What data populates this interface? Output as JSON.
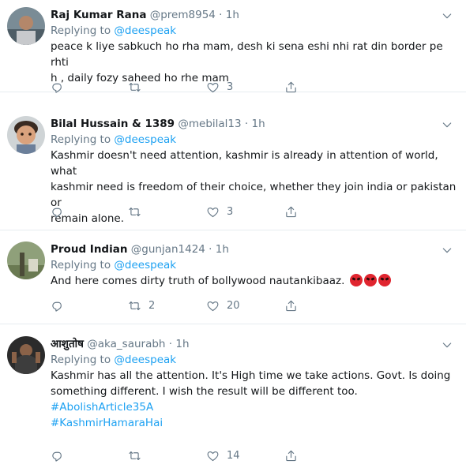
{
  "replying_label": "Replying to",
  "tweets": [
    {
      "name": "Raj Kumar Rana",
      "handle": "@prem8954",
      "dot": "·",
      "time": "1h",
      "mention": "@deespeak",
      "text_lines": [
        "peace k liye sabkuch ho rha mam, desh ki sena eshi nhi rat din border pe rhti",
        "h , daily fozy saheed ho rhe mam"
      ],
      "replies": "",
      "retweets": "",
      "likes": "3"
    },
    {
      "name": "Bilal Hussain & 1389",
      "handle": "@mebilal13",
      "dot": "·",
      "time": "1h",
      "mention": "@deespeak",
      "text_lines": [
        "Kashmir doesn't need attention, kashmir is already in attention of world, what",
        "kashmir need is freedom of their choice, whether they join india or pakistan or",
        "remain alone."
      ],
      "replies": "",
      "retweets": "",
      "likes": "3"
    },
    {
      "name": "Proud Indian",
      "handle": "@gunjan1424",
      "dot": "·",
      "time": "1h",
      "mention": "@deespeak",
      "text_lines": [
        "And here comes dirty truth of bollywood nautankibaaz."
      ],
      "emojis": [
        "angry-face-emoji",
        "angry-face-emoji",
        "angry-face-emoji"
      ],
      "replies": "",
      "retweets": "2",
      "likes": "20"
    },
    {
      "name": "आशुतोष",
      "handle": "@aka_saurabh",
      "dot": "·",
      "time": "1h",
      "mention": "@deespeak",
      "text_lines": [
        "Kashmir has all the attention. It's High time we take actions. Govt. Is doing",
        "something different. I wish the result will be different too."
      ],
      "hashtags": [
        "#AbolishArticle35A",
        "#KashmirHamaraHai"
      ],
      "replies": "",
      "retweets": "",
      "likes": "14"
    }
  ],
  "icons": {
    "reply": "reply-icon",
    "retweet": "retweet-icon",
    "like": "heart-icon",
    "share": "share-icon",
    "more": "chevron-down-icon"
  },
  "colors": {
    "link": "#1da1f2",
    "muted": "#657786",
    "text": "#14171a",
    "divider": "#e6ecf0"
  }
}
